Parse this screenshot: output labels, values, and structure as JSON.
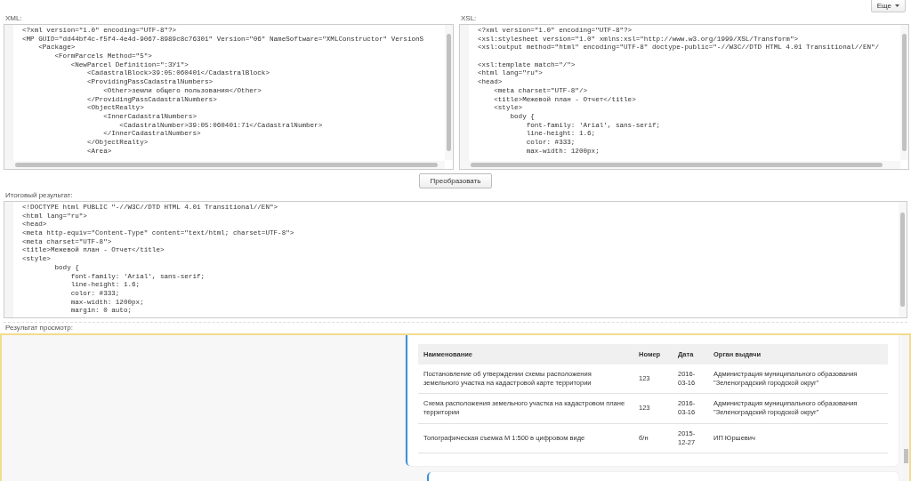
{
  "more_button": {
    "label": "Еще"
  },
  "xml_panel": {
    "label": "XML:",
    "lines": [
      "<?xml version=\"1.0\" encoding=\"UTF-8\"?>",
      "<MP GUID=\"dd44bf4c-f5f4-4e4d-9067-8989c8c76301\" Version=\"06\" NameSoftware=\"XMLConstructor\" VersionS",
      "    <Package>",
      "        <FormParcels Method=\"5\">",
      "            <NewParcel Definition=\":ЗУ1\">",
      "                <CadastralBlock>39:05:060401</CadastralBlock>",
      "                <ProvidingPassCadastralNumbers>",
      "                    <Other>земли общего пользования</Other>",
      "                </ProvidingPassCadastralNumbers>",
      "                <ObjectRealty>",
      "                    <InnerCadastralNumbers>",
      "                        <CadastralNumber>39:05:060401:71</CadastralNumber>",
      "                    </InnerCadastralNumbers>",
      "                </ObjectRealty>",
      "                <Area>"
    ]
  },
  "xsl_panel": {
    "label": "XSL:",
    "blocks": [
      [
        "<?xml version=\"1.0\" encoding=\"UTF-8\"?>",
        "<xsl:stylesheet version=\"1.0\" xmlns:xsl=\"http://www.w3.org/1999/XSL/Transform\">",
        "<xsl:output method=\"html\" encoding=\"UTF-8\" doctype-public=\"-//W3C//DTD HTML 4.01 Transitional//EN\"/"
      ],
      [
        "<xsl:template match=\"/\">",
        "<html lang=\"ru\">",
        "<head>",
        "    <meta charset=\"UTF-8\"/>",
        "    <title>Межевой план - Отчет</title>",
        "    <style>",
        "        body {",
        "            font-family: 'Arial', sans-serif;",
        "            line-height: 1.6;",
        "            color: #333;",
        "            max-width: 1200px;"
      ]
    ]
  },
  "transform_button": {
    "label": "Преобразовать"
  },
  "result_panel": {
    "label": "Итоговый результат:",
    "lines": [
      "<!DOCTYPE html PUBLIC \"-//W3C//DTD HTML 4.01 Transitional//EN\">",
      "<html lang=\"ru\">",
      "<head>",
      "<meta http-equiv=\"Content-Type\" content=\"text/html; charset=UTF-8\">",
      "<meta charset=\"UTF-8\">",
      "<title>Межевой план - Отчет</title>",
      "<style>",
      "        body {",
      "            font-family: 'Arial', sans-serif;",
      "            line-height: 1.6;",
      "            color: #333;",
      "            max-width: 1200px;",
      "            margin: 0 auto;"
    ]
  },
  "preview": {
    "label": "Результат просмотр:",
    "table": {
      "columns": [
        "Наименование",
        "Номер",
        "Дата",
        "Орган выдачи"
      ],
      "rows": [
        [
          "Постановление об утверждении схемы расположения земельного участка на кадастровой карте территории",
          "123",
          "2016-03-16",
          "Администрация муниципального образования \"Зеленоградский городской округ\""
        ],
        [
          "Схема расположения земельного участка на кадастровом плане территории",
          "123",
          "2016-03-16",
          "Администрация муниципального образования \"Зеленоградский городской округ\""
        ],
        [
          "Топографическая съемка М 1:500 в цифровом виде",
          "б/н",
          "2015-12-27",
          "ИП Юршевич"
        ]
      ]
    }
  }
}
